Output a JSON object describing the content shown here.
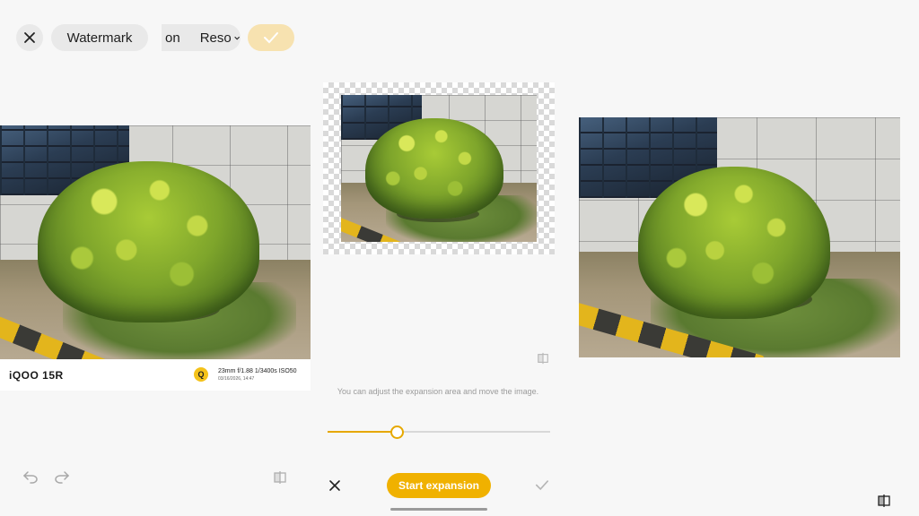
{
  "toolbar": {
    "watermark_label": "Watermark",
    "partial_tab_label": "on",
    "resolution_label": "Reso",
    "resolution_chevron": "chevron-down-icon"
  },
  "watermark": {
    "brand": "iQOO 15R",
    "logo_glyph": "Q",
    "specs": "23mm  f/1.88  1/3400s  ISO50",
    "datetime": "03/16/2026, 14:47"
  },
  "expansion": {
    "hint": "You can adjust the expansion area and move the image.",
    "slider_value": 0.31,
    "start_label": "Start expansion"
  },
  "colors": {
    "accent": "#f0b100",
    "confirm_pill": "#f7e2b0",
    "background": "#f7f7f7"
  },
  "icons": [
    "close-icon",
    "undo-icon",
    "redo-icon",
    "compare-icon",
    "check-icon"
  ]
}
